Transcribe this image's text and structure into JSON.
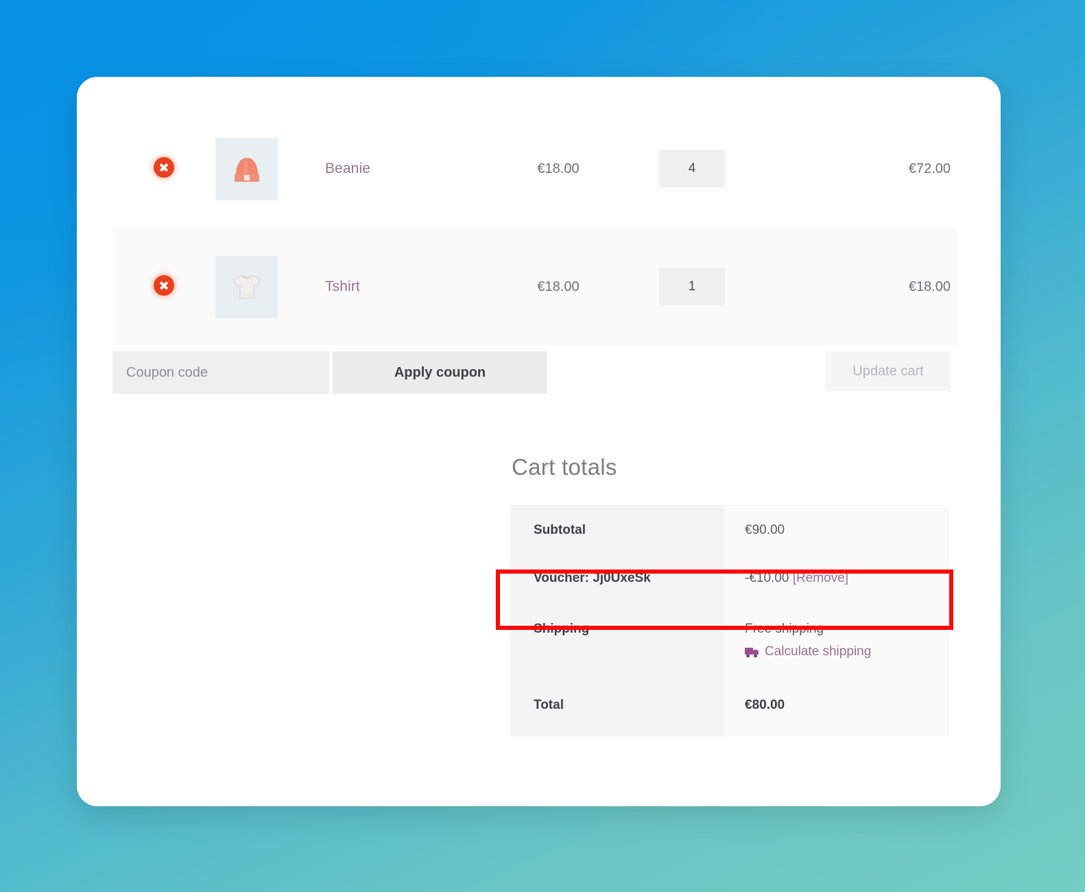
{
  "cart": {
    "items": [
      {
        "remove_label": "×",
        "thumb_icon": "beanie-thumbnail",
        "name": "Beanie",
        "price": "€18.00",
        "quantity": "4",
        "line_total": "€72.00"
      },
      {
        "remove_label": "×",
        "thumb_icon": "tshirt-thumbnail",
        "name": "Tshirt",
        "price": "€18.00",
        "quantity": "1",
        "line_total": "€18.00"
      }
    ],
    "coupon": {
      "placeholder": "Coupon code",
      "value": "",
      "apply_label": "Apply coupon"
    },
    "update_cart_label": "Update cart"
  },
  "totals": {
    "title": "Cart totals",
    "rows": {
      "subtotal_label": "Subtotal",
      "subtotal_value": "€90.00",
      "voucher_label": "Voucher: Jj0UxeSk",
      "voucher_amount": "-€10.00",
      "voucher_remove": "[Remove]",
      "shipping_label": "Shipping",
      "shipping_value": "Free shipping",
      "calculate_shipping_label": "Calculate shipping",
      "total_label": "Total",
      "total_value": "€80.00"
    }
  },
  "colors": {
    "accent_link": "#96738f",
    "remove_icon": "#e8401f",
    "highlight_box": "#fb0a0a",
    "bg_start": "#0891e5",
    "bg_end": "#74ccc2"
  }
}
